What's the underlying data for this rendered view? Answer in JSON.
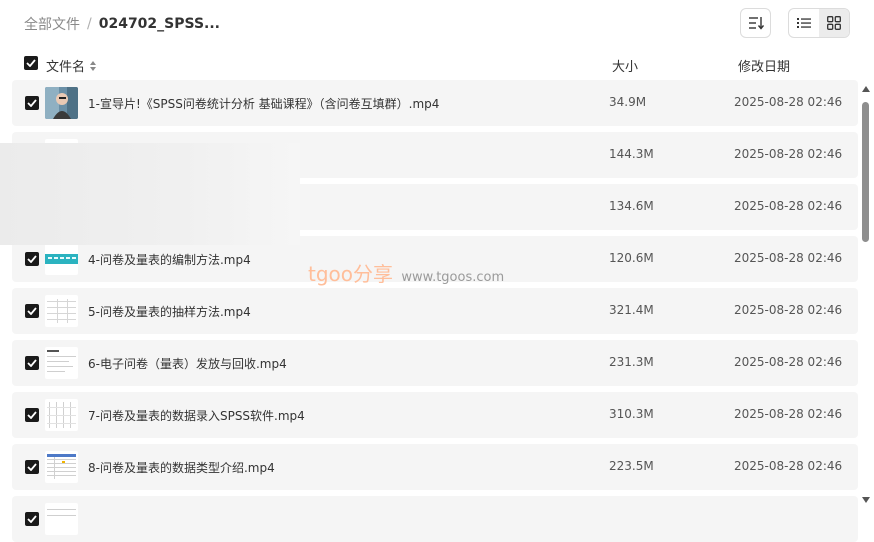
{
  "breadcrumb": {
    "root": "全部文件",
    "separator": "/",
    "current": "024702_SPSS..."
  },
  "toolbar": {
    "sort_icon": "sort-icon",
    "list_view_icon": "list-view-icon",
    "grid_view_icon": "grid-view-icon",
    "active_view": "list"
  },
  "columns": {
    "name": "文件名",
    "size": "大小",
    "modified": "修改日期"
  },
  "files": [
    {
      "name": "1-宣导片!《SPSS问卷统计分析 基础课程》（含问卷互填群）.mp4",
      "size": "34.9M",
      "modified": "2025-08-28 02:46",
      "checked": true
    },
    {
      "name": "",
      "size": "144.3M",
      "modified": "2025-08-28 02:46",
      "checked": true
    },
    {
      "name": "",
      "size": "134.6M",
      "modified": "2025-08-28 02:46",
      "checked": true
    },
    {
      "name": "4-问卷及量表的编制方法.mp4",
      "size": "120.6M",
      "modified": "2025-08-28 02:46",
      "checked": true
    },
    {
      "name": "5-问卷及量表的抽样方法.mp4",
      "size": "321.4M",
      "modified": "2025-08-28 02:46",
      "checked": true
    },
    {
      "name": "6-电子问卷（量表）发放与回收.mp4",
      "size": "231.3M",
      "modified": "2025-08-28 02:46",
      "checked": true
    },
    {
      "name": "7-问卷及量表的数据录入SPSS软件.mp4",
      "size": "310.3M",
      "modified": "2025-08-28 02:46",
      "checked": true
    },
    {
      "name": "8-问卷及量表的数据类型介绍.mp4",
      "size": "223.5M",
      "modified": "2025-08-28 02:46",
      "checked": true
    },
    {
      "name": "",
      "size": "",
      "modified": "",
      "checked": true
    }
  ],
  "watermark": {
    "brand": "tgoo分享",
    "url": "www.tgoos.com"
  },
  "colors": {
    "row_bg": "#f5f5f5",
    "checkbox": "#1a1a1a",
    "watermark": "#ffbe9a"
  }
}
